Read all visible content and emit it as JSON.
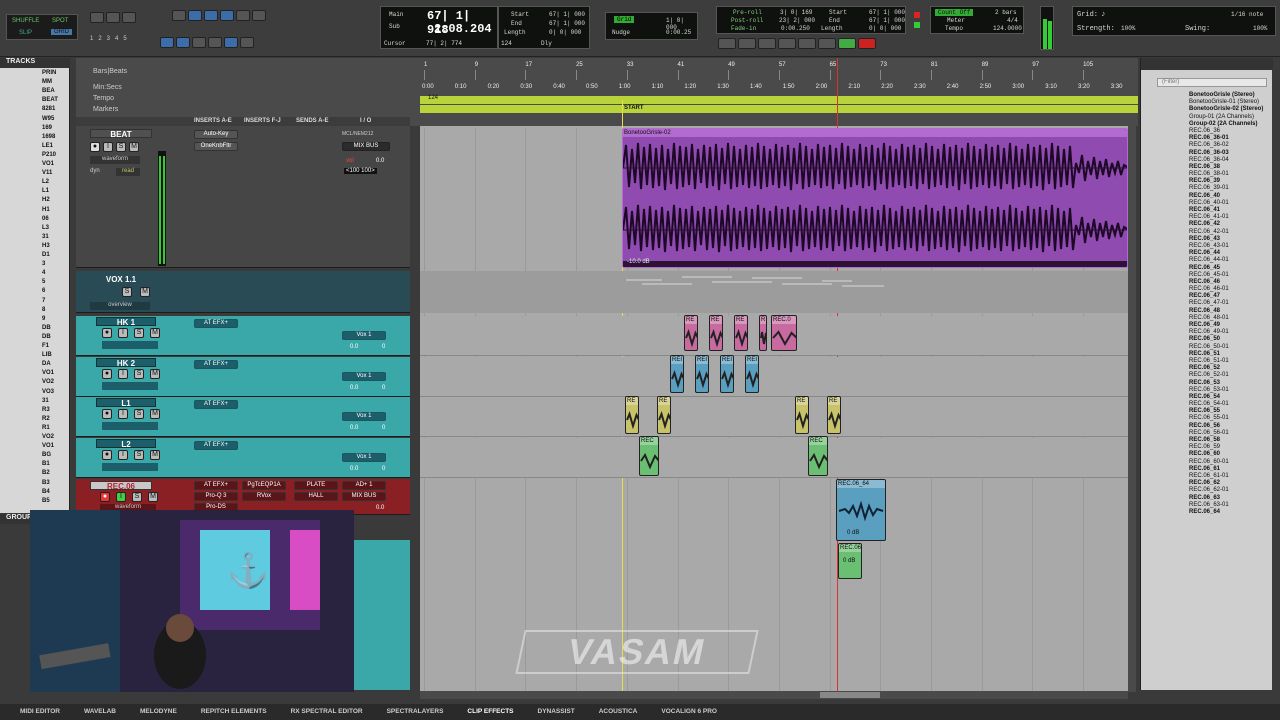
{
  "modes": {
    "shuffle": "SHUFFLE",
    "spot": "SPOT",
    "slip": "SLIP",
    "grid": "GRID"
  },
  "counters": {
    "main_label": "Main",
    "main_value": "67| 1| 918",
    "sub_label": "Sub",
    "sub_value": "2:08.204",
    "cursor_label": "Cursor",
    "cursor_value": "77| 2| 774",
    "bpm_value": "124",
    "dly_label": "Dly",
    "start_label": "Start",
    "end_label": "End",
    "length_label": "Length",
    "start_value": "67| 1| 000",
    "end_value": "67| 1| 000",
    "length_value": "0| 0| 000"
  },
  "grid_nudge": {
    "grid_label": "Grid",
    "grid_value": "1| 0| 000",
    "nudge_label": "Nudge",
    "nudge_value": "0:00.25"
  },
  "transport": {
    "preroll_label": "Pre-roll",
    "postroll_label": "Post-roll",
    "fadein_label": "Fade-in",
    "preroll_value": "3| 0| 169",
    "postroll_value": "23| 2| 000",
    "fadein_value": "0:00.250",
    "start_label": "Start",
    "end_label": "End",
    "length_label": "Length",
    "start_value": "67| 1| 000",
    "end_value": "67| 1| 000",
    "length_value": "0| 0| 000"
  },
  "meter": {
    "countoff_label": "Count Off",
    "countoff_value": "2 bars",
    "meter_label": "Meter",
    "meter_value": "4/4",
    "tempo_label": "Tempo",
    "tempo_value": "124.0000"
  },
  "grid_right": {
    "grid_label": "Grid:",
    "grid_value": "1/16 note",
    "strength_label": "Strength:",
    "strength_value": "100%",
    "swing_label": "Swing:",
    "swing_value": "100%"
  },
  "tracks_panel": {
    "title": "TRACKS",
    "items": [
      "PRIN",
      "MM",
      "BEA",
      "BEAT",
      "8281",
      "W95",
      "169",
      "1698",
      "LE1",
      "P210",
      "VO1",
      "V11",
      "L2",
      "L1",
      "H2",
      "H1",
      "06",
      "L3",
      "31",
      "H3",
      "D1",
      "3",
      "4",
      "5",
      "6",
      "7",
      "8",
      "9",
      "DB",
      "DB",
      "F1",
      "LIB",
      "DA",
      "VO1",
      "VO2",
      "VO3",
      "31",
      "R3",
      "R2",
      "R1",
      "VO2",
      "VO1",
      "BG",
      "B1",
      "B2",
      "B3",
      "B4",
      "B5"
    ],
    "group_title": "GROUP"
  },
  "rulers": {
    "bars_label": "Bars|Beats",
    "minsecs_label": "Min:Secs",
    "tempo_label": "Tempo",
    "markers_label": "Markers",
    "bars": [
      "1",
      "9",
      "17",
      "25",
      "33",
      "41",
      "49",
      "57",
      "65",
      "73",
      "81",
      "89",
      "97",
      "105"
    ],
    "times": [
      "0:00",
      "0:10",
      "0:20",
      "0:30",
      "0:40",
      "0:50",
      "1:00",
      "1:10",
      "1:20",
      "1:30",
      "1:40",
      "1:50",
      "2:00",
      "2:10",
      "2:20",
      "2:30",
      "2:40",
      "2:50",
      "3:00",
      "3:10",
      "3:20",
      "3:30"
    ],
    "tempo_value": "124",
    "marker": "START"
  },
  "columns": {
    "inserts_ae": "INSERTS A-E",
    "inserts_fj": "INSERTS F-J",
    "sends_ae": "SENDS A-E",
    "io": "I / O"
  },
  "beat": {
    "name": "BEAT",
    "inserts": [
      "Auto-Key",
      "OneKnbFltr"
    ],
    "send": "MIX BUS",
    "io": "MCL/NEM212",
    "view": "waveform",
    "auto": "read",
    "dyn": "dyn",
    "vol_label": "vol",
    "vol": "0.0",
    "pan": "<100  100>",
    "clip_name": "BonetooGrisle-02",
    "clip_gain": "-10.0 dB"
  },
  "vox": {
    "name": "VOX 1.1",
    "sub": "overview"
  },
  "subtracks": [
    {
      "name": "HK 1",
      "insert": "AT EFX+",
      "out": "Vox 1",
      "vol": "0.0",
      "pan": "0"
    },
    {
      "name": "HK 2",
      "insert": "AT EFX+",
      "out": "Vox 1",
      "vol": "0.0",
      "pan": "0"
    },
    {
      "name": "L1",
      "insert": "AT EFX+",
      "out": "Vox 1",
      "vol": "0.0",
      "pan": "0"
    },
    {
      "name": "L2",
      "insert": "AT EFX+",
      "out": "Vox 1",
      "vol": "0.0",
      "pan": "0"
    }
  ],
  "rec": {
    "name": "REC.06",
    "inserts": [
      "AT EFX+",
      "Pro-Q 3",
      "Pro-DS"
    ],
    "inserts2": [
      "PgTcEQP1A",
      "RVox"
    ],
    "sends": [
      "PLATE",
      "HALL"
    ],
    "io": "AD+ 1",
    "bus": "MIX BUS",
    "view": "waveform",
    "vol": "0.0",
    "clip1": "REC.06_64",
    "clip1_gain": "0 dB",
    "clip2": "REC.06",
    "clip2_gain": "0 dB"
  },
  "clips": {
    "hk1": [
      "RE",
      "RE",
      "RE",
      "R",
      "REC.0"
    ],
    "hk2": [
      "REI",
      "REI",
      "REI",
      "REI"
    ],
    "l1": [
      "RE",
      "RE",
      "RE",
      "RE"
    ],
    "l2": [
      "REC",
      "REC"
    ]
  },
  "clip_list": {
    "filter_placeholder": "(Filter)",
    "items": [
      "BonetooGrisle (Stereo)",
      "BonetooGrisle-01 (Stereo)",
      "BonetooGrisle-02 (Stereo)",
      "Group-01 (2A Channels)",
      "Group-02 (2A Channels)",
      "REC.06_36",
      "REC.06_36-01",
      "REC.06_36-02",
      "REC.06_36-03",
      "REC.06_36-04",
      "REC.06_38",
      "REC.06_38-01",
      "REC.06_39",
      "REC.06_39-01",
      "REC.06_40",
      "REC.06_40-01",
      "REC.06_41",
      "REC.06_41-01",
      "REC.06_42",
      "REC.06_42-01",
      "REC.06_43",
      "REC.06_43-01",
      "REC.06_44",
      "REC.06_44-01",
      "REC.06_45",
      "REC.06_45-01",
      "REC.06_46",
      "REC.06_46-01",
      "REC.06_47",
      "REC.06_47-01",
      "REC.06_48",
      "REC.06_48-01",
      "REC.06_49",
      "REC.06_49-01",
      "REC.06_50",
      "REC.06_50-01",
      "REC.06_51",
      "REC.06_51-01",
      "REC.06_52",
      "REC.06_52-01",
      "REC.06_53",
      "REC.06_53-01",
      "REC.06_54",
      "REC.06_54-01",
      "REC.06_55",
      "REC.06_55-01",
      "REC.06_56",
      "REC.06_56-01",
      "REC.06_58",
      "REC.06_59",
      "REC.06_60",
      "REC.06_60-01",
      "REC.06_61",
      "REC.06_61-01",
      "REC.06_62",
      "REC.06_62-01",
      "REC.06_63",
      "REC.06_63-01",
      "REC.06_64"
    ]
  },
  "watermark": "VASAM",
  "bottom_tabs": [
    "MIDI EDITOR",
    "WAVELAB",
    "MELODYNE",
    "REPITCH ELEMENTS",
    "RX SPECTRAL EDITOR",
    "SPECTRALAYERS",
    "CLIP EFFECTS",
    "DYNASSIST",
    "ACOUSTICA",
    "VOCALIGN 6 PRO"
  ],
  "colors": {
    "beat_clip": "#9a56b8",
    "teal": "#3aa7a8",
    "pink": "#c76aa0",
    "blue": "#5a9ec0",
    "yellow": "#c8c26a",
    "green": "#6bbf73",
    "rec_red": "#b8212f",
    "ruler_green": "#b8d43a"
  }
}
